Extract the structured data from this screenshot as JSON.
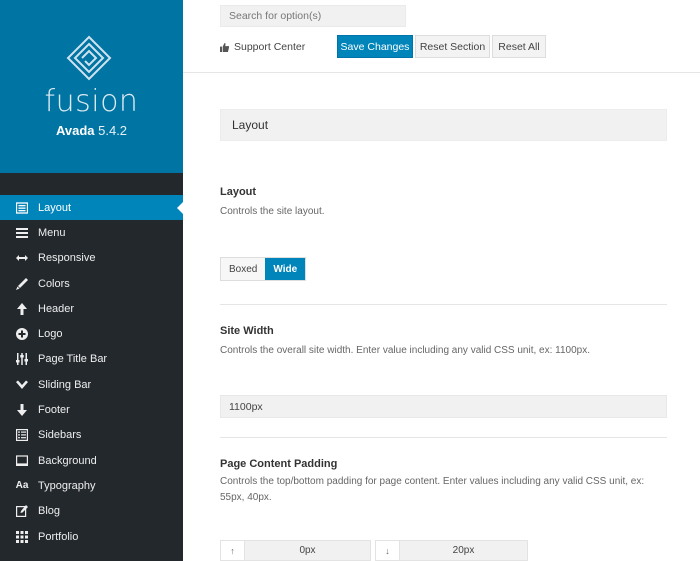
{
  "brand": {
    "name": "fusion",
    "product": "Avada",
    "version": "5.4.2",
    "color": "#0074a2"
  },
  "sidebar": {
    "items": [
      {
        "label": "Layout",
        "icon": "layout-icon",
        "active": true
      },
      {
        "label": "Menu",
        "icon": "menu-icon"
      },
      {
        "label": "Responsive",
        "icon": "arrows-horizontal-icon"
      },
      {
        "label": "Colors",
        "icon": "brush-icon"
      },
      {
        "label": "Header",
        "icon": "arrow-up-icon"
      },
      {
        "label": "Logo",
        "icon": "plus-circle-icon"
      },
      {
        "label": "Page Title Bar",
        "icon": "sliders-icon"
      },
      {
        "label": "Sliding Bar",
        "icon": "chevron-down-icon"
      },
      {
        "label": "Footer",
        "icon": "arrow-down-icon"
      },
      {
        "label": "Sidebars",
        "icon": "sidebars-icon"
      },
      {
        "label": "Background",
        "icon": "monitor-icon"
      },
      {
        "label": "Typography",
        "icon": "typography-icon"
      },
      {
        "label": "Blog",
        "icon": "edit-icon"
      },
      {
        "label": "Portfolio",
        "icon": "grid-icon"
      }
    ]
  },
  "topbar": {
    "search_placeholder": "Search for option(s)",
    "support_label": "Support Center",
    "save_label": "Save Changes",
    "reset_section_label": "Reset Section",
    "reset_all_label": "Reset All"
  },
  "section": {
    "title": "Layout"
  },
  "fields": {
    "layout": {
      "title": "Layout",
      "desc": "Controls the site layout.",
      "options": [
        "Boxed",
        "Wide"
      ],
      "selected": "Wide"
    },
    "site_width": {
      "title": "Site Width",
      "desc": "Controls the overall site width. Enter value including any valid CSS unit, ex: 1100px.",
      "value": "1100px"
    },
    "padding": {
      "title": "Page Content Padding",
      "desc": "Controls the top/bottom padding for page content. Enter values including any valid CSS unit, ex: 55px, 40px.",
      "top_value": "0px",
      "bottom_value": "20px",
      "top_icon": "↑",
      "bottom_icon": "↓"
    }
  }
}
